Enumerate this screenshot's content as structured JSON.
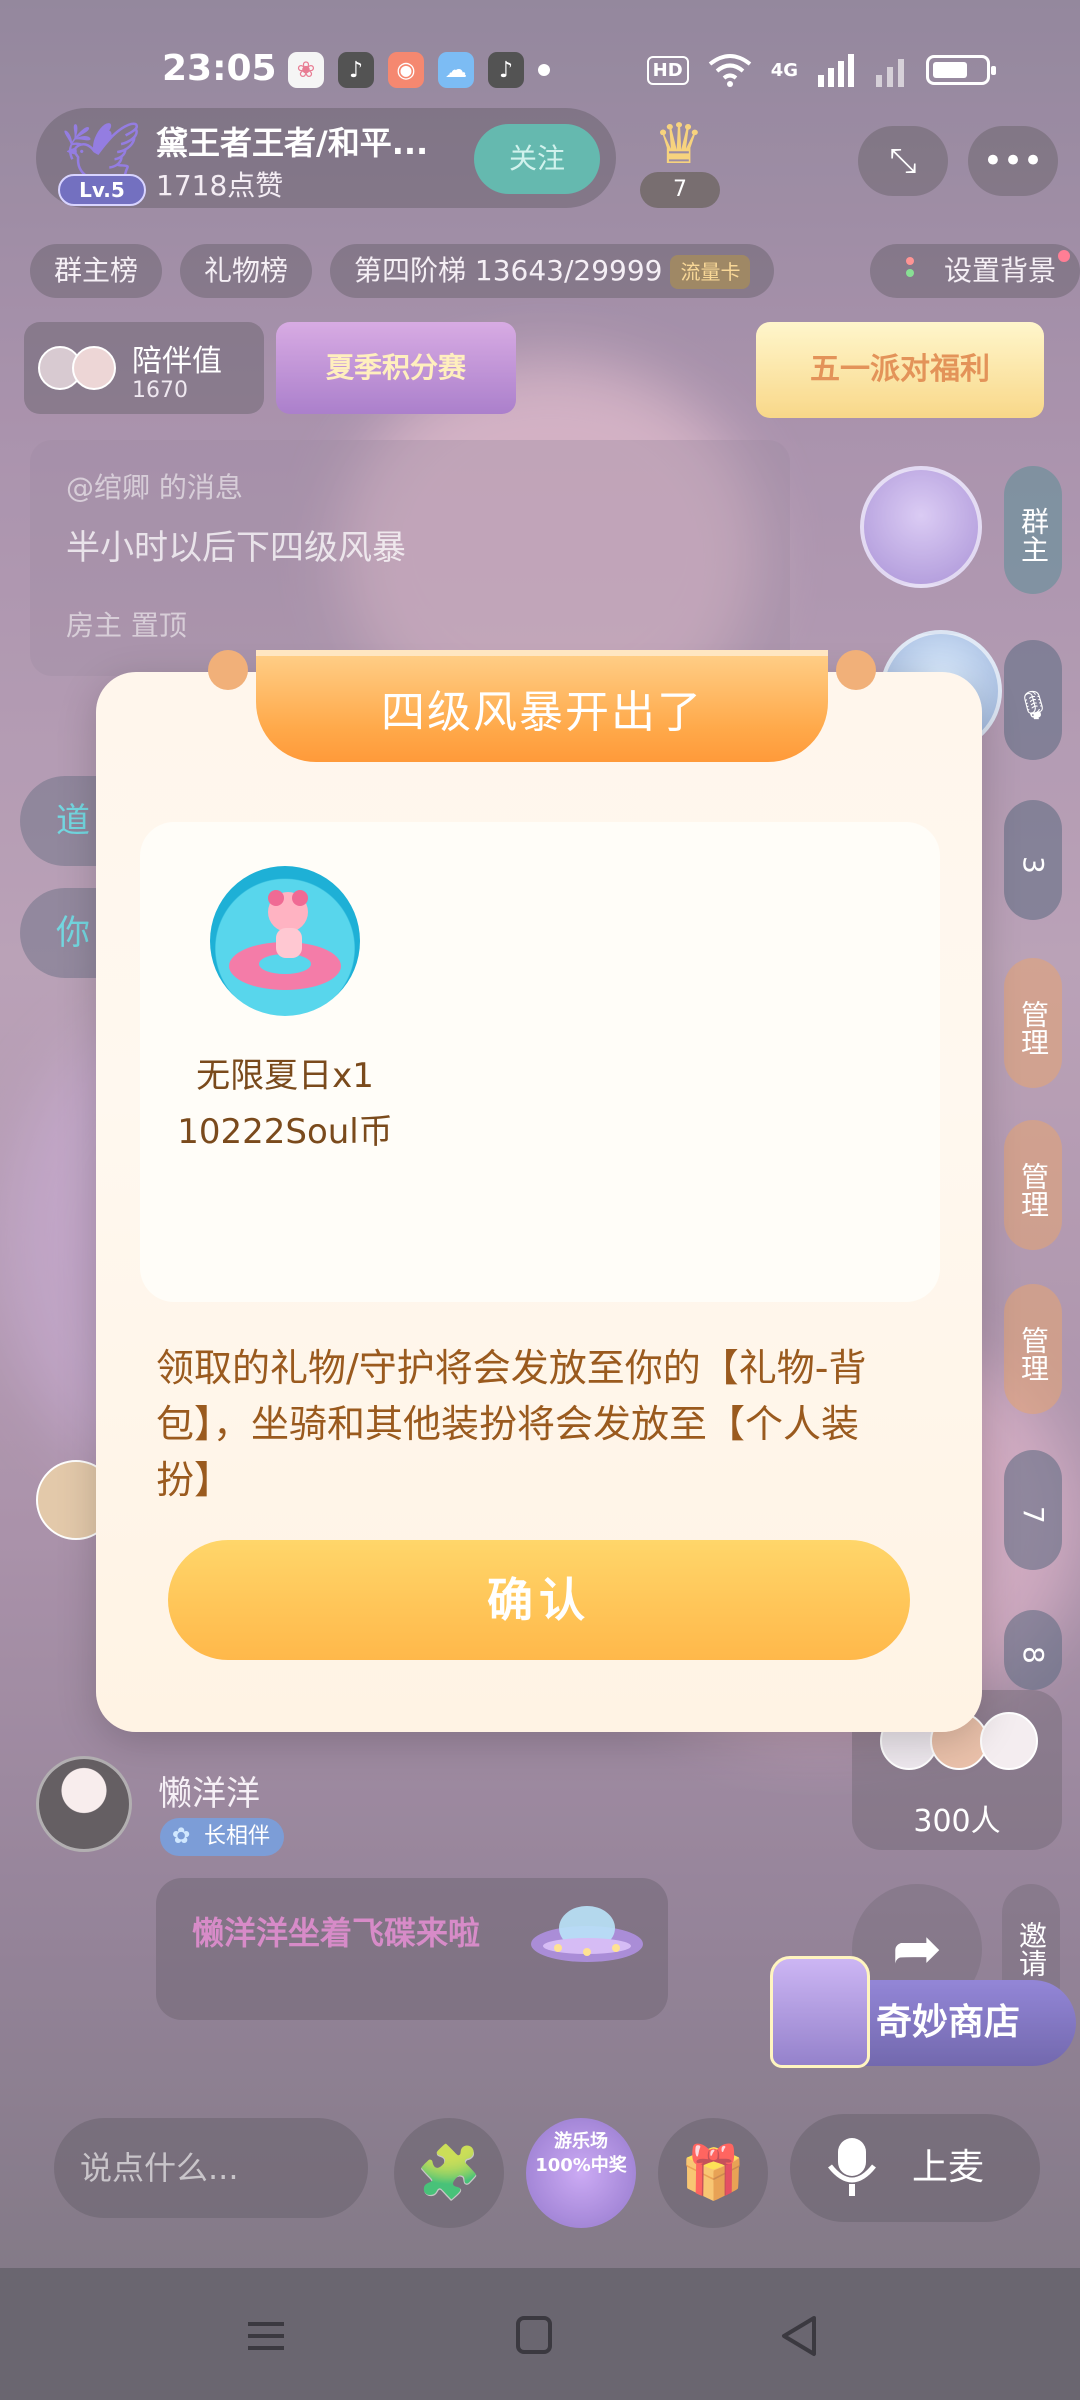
{
  "status_bar": {
    "time": "23:05",
    "network": "4G",
    "hd_label": "HD",
    "apps": [
      "app-1",
      "tiktok-icon",
      "app-3",
      "weather-icon",
      "tiktok-icon"
    ]
  },
  "header": {
    "host_name": "黛王者王者/和平...",
    "host_likes": "1718点赞",
    "level": "Lv.5",
    "follow_label": "关注",
    "crown_count": "7"
  },
  "chips": {
    "group_rank": "群主榜",
    "gift_rank": "礼物榜",
    "ladder": "第四阶梯 13643/29999",
    "flow_card": "流量卡",
    "set_background": "设置背景"
  },
  "companion": {
    "label": "陪伴值",
    "value": "1670"
  },
  "banners": {
    "summer": "夏季积分赛",
    "party": "五一派对福利"
  },
  "pinned_message": {
    "at": "@绾卿 的消息",
    "body": "半小时以后下四级风暴",
    "footer": "房主 置顶"
  },
  "side_seats": {
    "group_owner": "群主",
    "seat_3": "3",
    "manager_1": "管理",
    "manager_2": "管理",
    "manager_3": "管理",
    "seat_7": "7",
    "seat_8": "8"
  },
  "left_pills": {
    "pill_1": "道",
    "pill_2": "你"
  },
  "chat": {
    "user_name": "懒洋洋",
    "user_tag": "长相伴",
    "message": "懒洋洋坐着飞碟来啦"
  },
  "online": {
    "count": "300人"
  },
  "actions": {
    "invite_label": "邀请",
    "shop_label": "奇妙商店",
    "game_label": "游乐场\n100%中奖",
    "mic_label": "上麦",
    "input_placeholder": "说点什么..."
  },
  "modal": {
    "title": "四级风暴开出了",
    "gift_name": "无限夏日x1",
    "gift_price": "10222Soul币",
    "notice": "领取的礼物/守护将会发放至你的【礼物-背包】，坐骑和其他装扮将会发放至【个人装扮】",
    "confirm_label": "确认"
  },
  "colors": {
    "accent_orange": "#ffa94a",
    "confirm_yellow": "#ffc14f",
    "follow_teal": "#2a9e90",
    "modal_text": "#9a5a1e"
  }
}
